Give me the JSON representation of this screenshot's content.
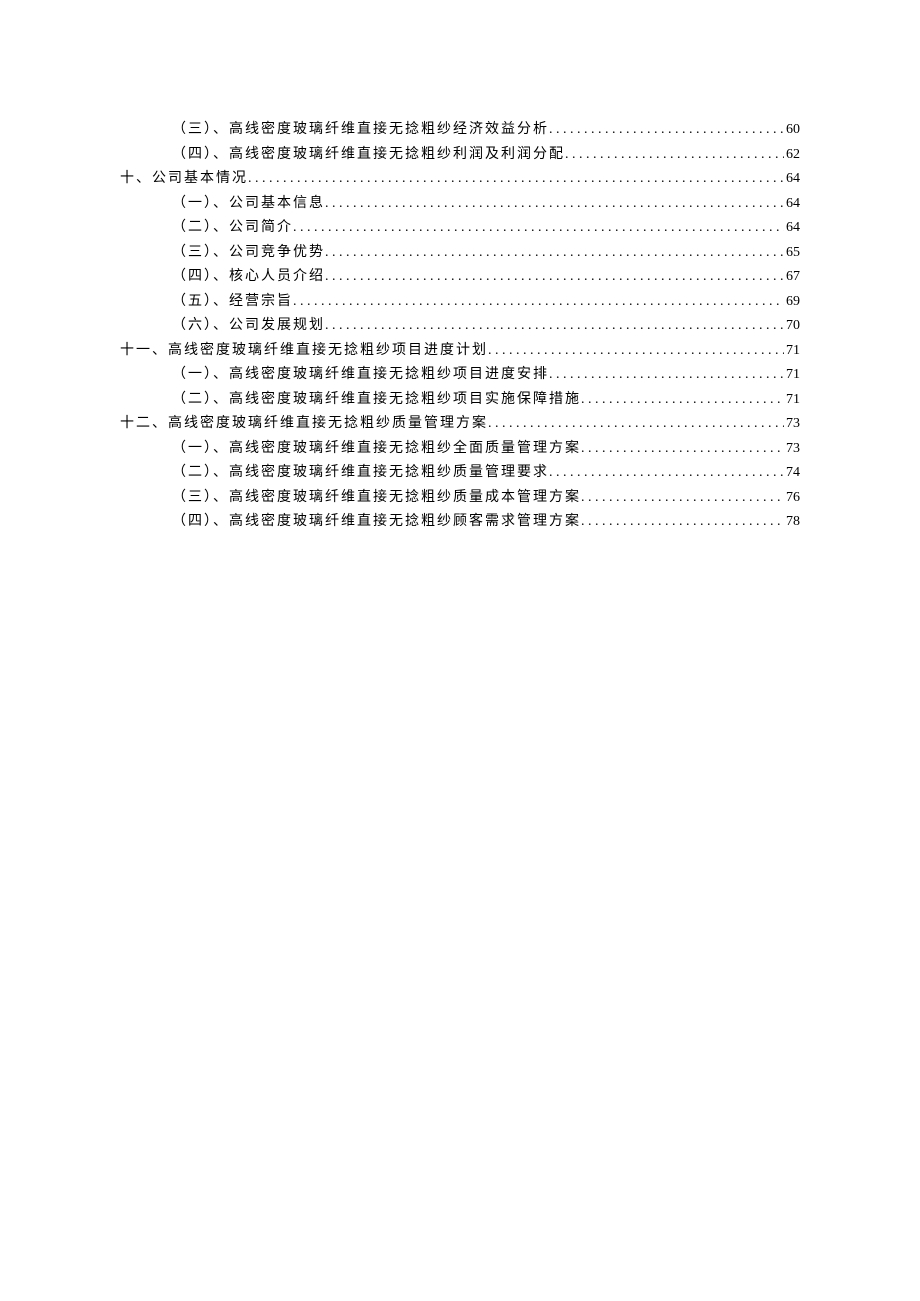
{
  "toc": [
    {
      "level": 2,
      "title": "（三）、高线密度玻璃纤维直接无捻粗纱经济效益分析",
      "page": "60"
    },
    {
      "level": 2,
      "title": "（四）、高线密度玻璃纤维直接无捻粗纱利润及利润分配",
      "page": "62"
    },
    {
      "level": 1,
      "title": "十、公司基本情况",
      "page": "64"
    },
    {
      "level": 2,
      "title": "（一）、公司基本信息",
      "page": "64"
    },
    {
      "level": 2,
      "title": "（二）、公司简介",
      "page": "64"
    },
    {
      "level": 2,
      "title": "（三）、公司竞争优势",
      "page": "65"
    },
    {
      "level": 2,
      "title": "（四）、核心人员介绍",
      "page": "67"
    },
    {
      "level": 2,
      "title": "（五）、经营宗旨",
      "page": "69"
    },
    {
      "level": 2,
      "title": "（六）、公司发展规划",
      "page": "70"
    },
    {
      "level": 1,
      "title": "十一、高线密度玻璃纤维直接无捻粗纱项目进度计划",
      "page": "71"
    },
    {
      "level": 2,
      "title": "（一）、高线密度玻璃纤维直接无捻粗纱项目进度安排",
      "page": "71"
    },
    {
      "level": 2,
      "title": "（二）、高线密度玻璃纤维直接无捻粗纱项目实施保障措施",
      "page": "71"
    },
    {
      "level": 1,
      "title": "十二、高线密度玻璃纤维直接无捻粗纱质量管理方案",
      "page": "73"
    },
    {
      "level": 2,
      "title": "（一）、高线密度玻璃纤维直接无捻粗纱全面质量管理方案",
      "page": "73"
    },
    {
      "level": 2,
      "title": "（二）、高线密度玻璃纤维直接无捻粗纱质量管理要求",
      "page": "74"
    },
    {
      "level": 2,
      "title": "（三）、高线密度玻璃纤维直接无捻粗纱质量成本管理方案",
      "page": "76"
    },
    {
      "level": 2,
      "title": "（四）、高线密度玻璃纤维直接无捻粗纱顾客需求管理方案",
      "page": "78"
    }
  ]
}
